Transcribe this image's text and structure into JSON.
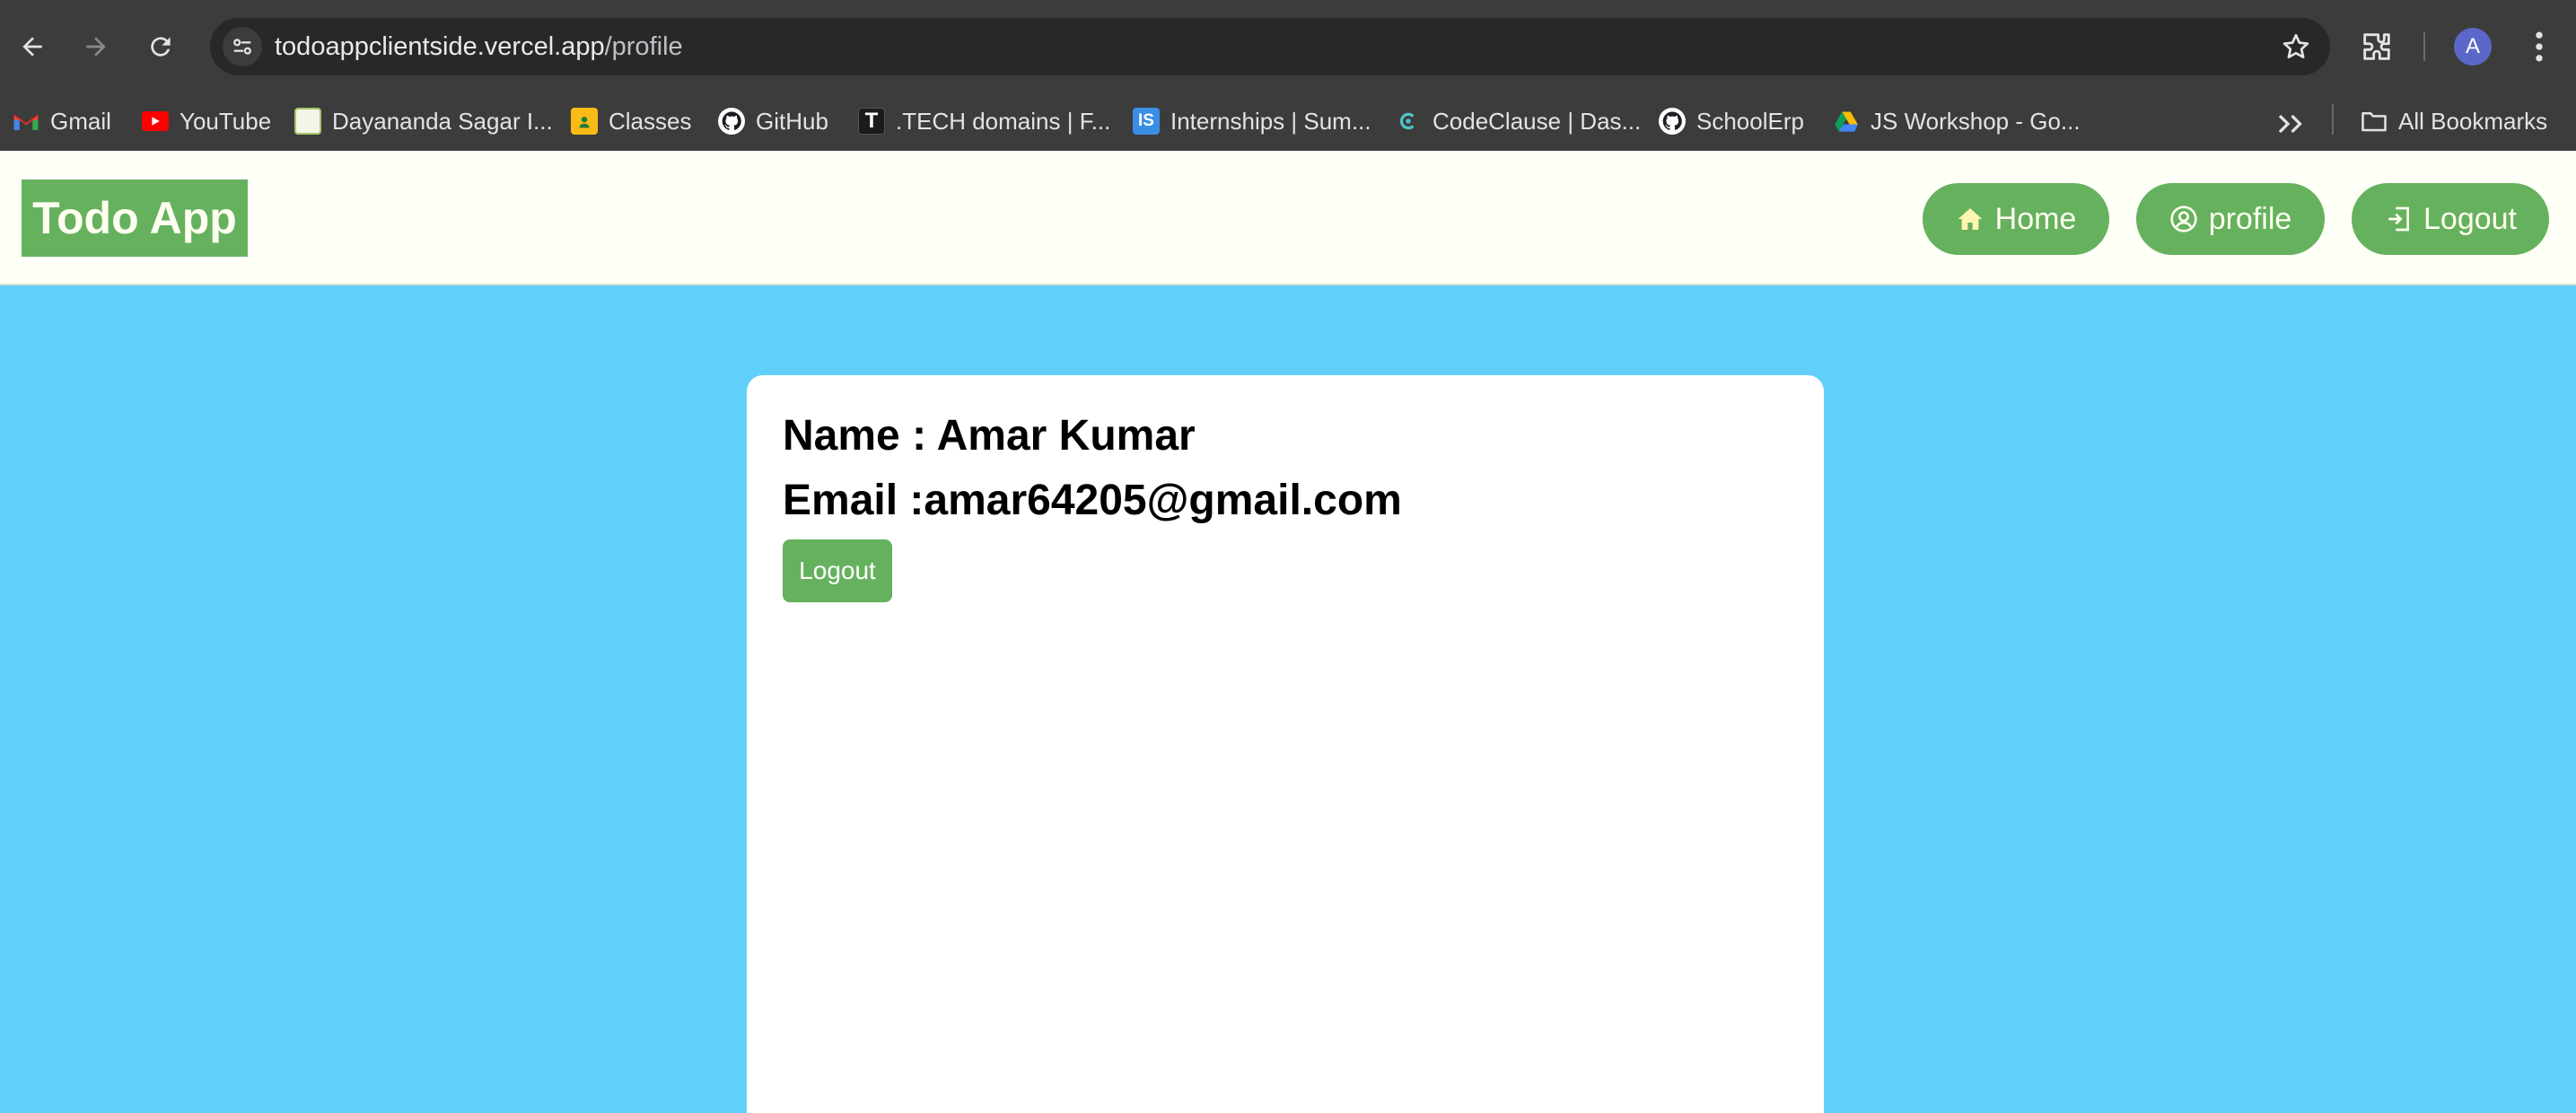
{
  "browser": {
    "url_host": "todoappclientside.vercel.app",
    "url_path": "/profile",
    "profile_initial": "A",
    "bookmarks": [
      {
        "label": "Gmail",
        "icon": "gmail-icon"
      },
      {
        "label": "YouTube",
        "icon": "youtube-icon"
      },
      {
        "label": "Dayananda Sagar I...",
        "icon": "dayananda-icon"
      },
      {
        "label": "Classes",
        "icon": "classroom-icon"
      },
      {
        "label": "GitHub",
        "icon": "github-icon"
      },
      {
        "label": ".TECH domains | F...",
        "icon": "tech-domains-icon"
      },
      {
        "label": "Internships | Sum...",
        "icon": "internshala-icon"
      },
      {
        "label": "CodeClause | Das...",
        "icon": "codeclause-icon"
      },
      {
        "label": "SchoolErp",
        "icon": "github-icon"
      },
      {
        "label": "JS Workshop - Go...",
        "icon": "google-drive-icon"
      }
    ],
    "all_bookmarks_label": "All Bookmarks"
  },
  "header": {
    "logo": "Todo App",
    "nav": [
      {
        "label": "Home",
        "icon": "home-icon"
      },
      {
        "label": "profile",
        "icon": "user-circle-icon"
      },
      {
        "label": "Logout",
        "icon": "logout-icon"
      }
    ]
  },
  "profile": {
    "name_line": "Name : Amar Kumar",
    "email_line": "Email :amar64205@gmail.com",
    "logout_label": "Logout"
  },
  "colors": {
    "page_background": "#60d0fb",
    "accent_green": "#66b15e",
    "header_background": "#fefff6"
  }
}
